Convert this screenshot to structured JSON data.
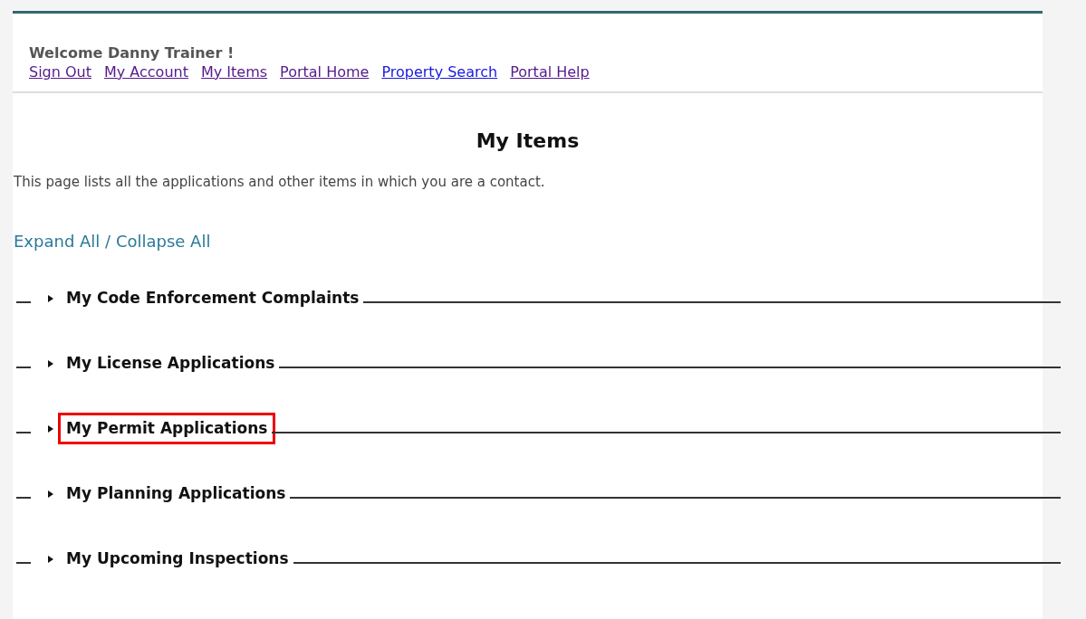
{
  "header": {
    "welcome": "Welcome Danny Trainer !",
    "links": [
      {
        "label": "Sign Out",
        "visited": true
      },
      {
        "label": "My Account",
        "visited": true
      },
      {
        "label": "My Items",
        "visited": true
      },
      {
        "label": "Portal Home",
        "visited": true
      },
      {
        "label": "Property Search",
        "visited": false
      },
      {
        "label": "Portal Help",
        "visited": true
      }
    ]
  },
  "title": "My Items",
  "description": "This page lists all the applications and other items in which you are a contact.",
  "expand_all": "Expand All",
  "separator": "/",
  "collapse_all": "Collapse All",
  "sections": [
    {
      "label": "My Code Enforcement Complaints",
      "expanded": false,
      "highlighted": false
    },
    {
      "label": "My License Applications",
      "expanded": false,
      "highlighted": false
    },
    {
      "label": "My Permit Applications",
      "expanded": false,
      "highlighted": true
    },
    {
      "label": "My Planning Applications",
      "expanded": false,
      "highlighted": false
    },
    {
      "label": "My Upcoming Inspections",
      "expanded": false,
      "highlighted": false
    }
  ]
}
